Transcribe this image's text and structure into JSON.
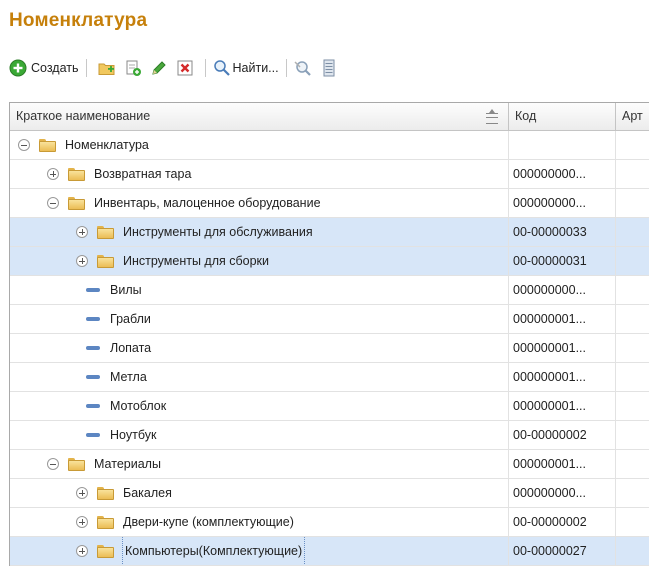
{
  "window": {
    "title": "Номенклатура"
  },
  "toolbar": {
    "create_label": "Создать",
    "find_label": "Найти...",
    "icons": [
      "add-circle-icon",
      "new-folder-icon",
      "copy-icon",
      "edit-pencil-icon",
      "delete-x-icon",
      "search-icon",
      "search-cancel-icon",
      "list-icon"
    ]
  },
  "table": {
    "columns": [
      "Краткое наименование",
      "Код",
      "Арт"
    ],
    "rows": [
      {
        "level": 0,
        "kind": "folder",
        "toggle": "minus",
        "name": "Номенклатура",
        "code": "",
        "selected": false
      },
      {
        "level": 1,
        "kind": "folder",
        "toggle": "plus",
        "name": "Возвратная тара",
        "code": "000000000...",
        "selected": false
      },
      {
        "level": 1,
        "kind": "folder",
        "toggle": "minus",
        "name": "Инвентарь, малоценное оборудование",
        "code": "000000000...",
        "selected": false
      },
      {
        "level": 2,
        "kind": "folder",
        "toggle": "plus",
        "name": "Инструменты для обслуживания",
        "code": "00-00000033",
        "selected": true
      },
      {
        "level": 2,
        "kind": "folder",
        "toggle": "plus",
        "name": "Инструменты для сборки",
        "code": "00-00000031",
        "selected": true
      },
      {
        "level": 2,
        "kind": "item",
        "toggle": "",
        "name": "Вилы",
        "code": "000000000...",
        "selected": false
      },
      {
        "level": 2,
        "kind": "item",
        "toggle": "",
        "name": "Грабли",
        "code": "000000001...",
        "selected": false
      },
      {
        "level": 2,
        "kind": "item",
        "toggle": "",
        "name": "Лопата",
        "code": "000000001...",
        "selected": false
      },
      {
        "level": 2,
        "kind": "item",
        "toggle": "",
        "name": "Метла",
        "code": "000000001...",
        "selected": false
      },
      {
        "level": 2,
        "kind": "item",
        "toggle": "",
        "name": "Мотоблок",
        "code": "000000001...",
        "selected": false
      },
      {
        "level": 2,
        "kind": "item",
        "toggle": "",
        "name": "Ноутбук",
        "code": "00-00000002",
        "selected": false
      },
      {
        "level": 1,
        "kind": "folder",
        "toggle": "minus",
        "name": "Материалы",
        "code": "000000001...",
        "selected": false
      },
      {
        "level": 2,
        "kind": "folder",
        "toggle": "plus",
        "name": "Бакалея",
        "code": "000000000...",
        "selected": false
      },
      {
        "level": 2,
        "kind": "folder",
        "toggle": "plus",
        "name": "Двери-купе (комплектующие)",
        "code": "00-00000002",
        "selected": false
      },
      {
        "level": 2,
        "kind": "folder",
        "toggle": "plus",
        "name": "Компьютеры(Комплектующие)",
        "code": "00-00000027",
        "selected": true,
        "focused": true
      }
    ]
  },
  "colors": {
    "title": "#c6800b",
    "selection": "#d7e6f8",
    "folder": "#ebbd55",
    "item_marker": "#5c86c2"
  }
}
